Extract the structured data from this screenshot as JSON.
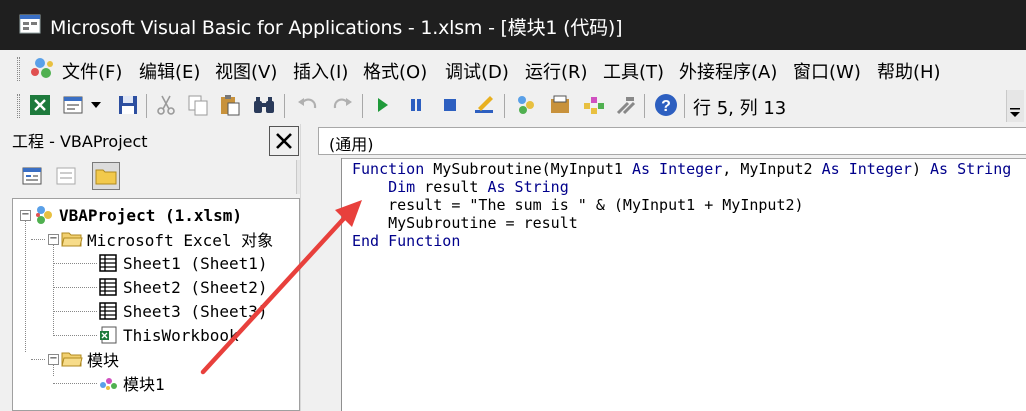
{
  "window": {
    "title": "Microsoft Visual Basic for Applications - 1.xlsm - [模块1 (代码)]"
  },
  "menu": {
    "items": [
      {
        "label": "文件(F)"
      },
      {
        "label": "编辑(E)"
      },
      {
        "label": "视图(V)"
      },
      {
        "label": "插入(I)"
      },
      {
        "label": "格式(O)"
      },
      {
        "label": "调试(D)"
      },
      {
        "label": "运行(R)"
      },
      {
        "label": "工具(T)"
      },
      {
        "label": "外接程序(A)"
      },
      {
        "label": "窗口(W)"
      },
      {
        "label": "帮助(H)"
      }
    ]
  },
  "toolbar": {
    "position_status": "行 5, 列 13",
    "icons": [
      "excel-icon",
      "insert-userform-icon",
      "save-icon",
      "cut-icon",
      "copy-icon",
      "paste-icon",
      "find-icon",
      "undo-icon",
      "redo-icon",
      "run-icon",
      "break-icon",
      "reset-icon",
      "design-mode-icon",
      "project-explorer-icon",
      "properties-icon",
      "object-browser-icon",
      "toolbox-icon",
      "help-icon"
    ]
  },
  "project_pane": {
    "title": "工程 - VBAProject",
    "tree": {
      "root": "VBAProject (1.xlsm)",
      "excel_objects_folder": "Microsoft Excel 对象",
      "sheets": [
        "Sheet1 (Sheet1)",
        "Sheet2 (Sheet2)",
        "Sheet3 (Sheet3)"
      ],
      "workbook": "ThisWorkbook",
      "modules_folder": "模块",
      "module": "模块1"
    }
  },
  "code_window": {
    "object_combo": "(通用)",
    "lines": [
      [
        {
          "t": "Function ",
          "kw": true
        },
        {
          "t": "MySubroutine(MyInput1 ",
          "kw": false
        },
        {
          "t": "As Integer",
          "kw": true
        },
        {
          "t": ", MyInput2 ",
          "kw": false
        },
        {
          "t": "As Integer",
          "kw": true
        },
        {
          "t": ") ",
          "kw": false
        },
        {
          "t": "As String",
          "kw": true
        }
      ],
      [
        {
          "t": "    ",
          "kw": false
        },
        {
          "t": "Dim",
          "kw": true
        },
        {
          "t": " result ",
          "kw": false
        },
        {
          "t": "As String",
          "kw": true
        }
      ],
      [
        {
          "t": "    result = \"The sum is \" & (MyInput1 + MyInput2)",
          "kw": false
        }
      ],
      [
        {
          "t": "    MySubroutine = result",
          "kw": false
        }
      ],
      [
        {
          "t": "End Function",
          "kw": true
        }
      ]
    ]
  },
  "colors": {
    "keyword": "#00008b",
    "annotation_arrow": "#e8403c",
    "titlebar": "#1f1f1f"
  }
}
